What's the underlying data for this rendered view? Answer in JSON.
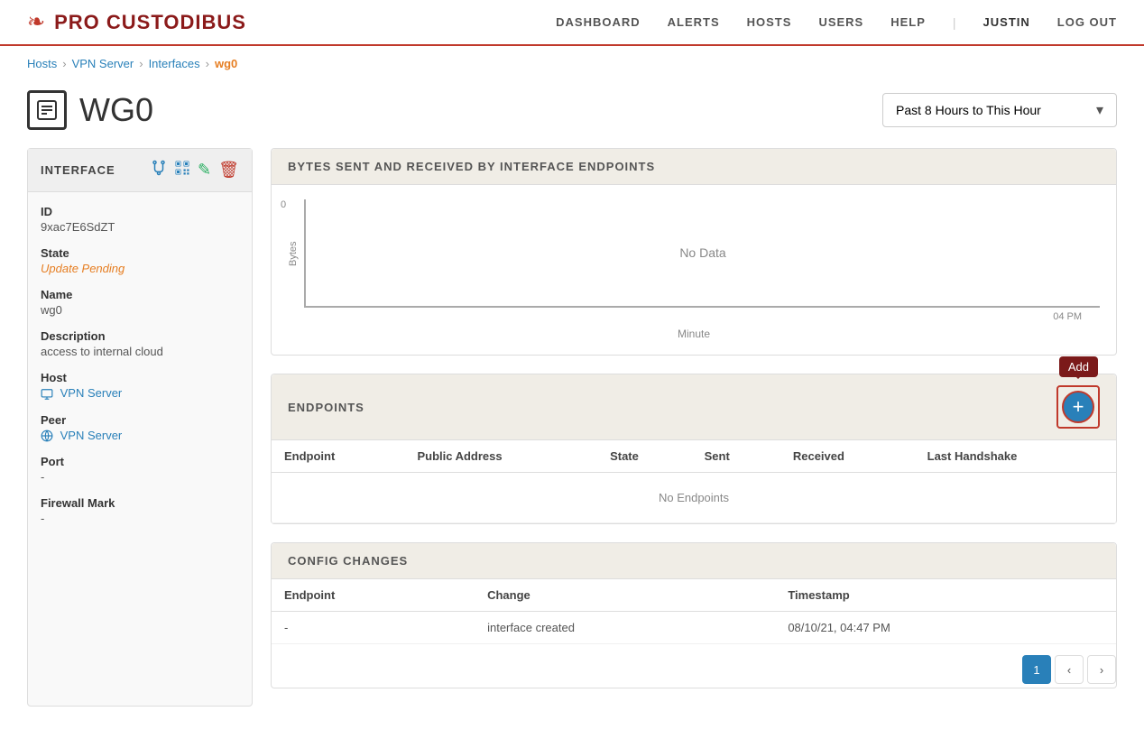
{
  "header": {
    "logo_text": "PRO CUSTODIBUS",
    "logo_icon": "❧",
    "nav": {
      "dashboard": "DASHBOARD",
      "alerts": "ALERTS",
      "hosts": "HOSTS",
      "users": "USERS",
      "help": "HELP",
      "username": "JUSTIN",
      "logout": "LOG OUT"
    }
  },
  "breadcrumb": {
    "hosts": "Hosts",
    "vpn_server": "VPN Server",
    "interfaces": "Interfaces",
    "current": "wg0"
  },
  "page_title": "WG0",
  "time_selector": {
    "label": "Past 8 Hours to This Hour",
    "chevron": "▾"
  },
  "sidebar": {
    "header_title": "INTERFACE",
    "icons": {
      "fork": "⑂",
      "qr": "⊞",
      "edit": "✎",
      "delete": "🗑"
    },
    "fields": {
      "id_label": "ID",
      "id_value": "9xac7E6SdZT",
      "state_label": "State",
      "state_value": "Update Pending",
      "name_label": "Name",
      "name_value": "wg0",
      "description_label": "Description",
      "description_value": "access to internal cloud",
      "host_label": "Host",
      "host_value": "VPN Server",
      "peer_label": "Peer",
      "peer_value": "VPN Server",
      "port_label": "Port",
      "port_value": "-",
      "firewall_mark_label": "Firewall Mark",
      "firewall_mark_value": "-"
    }
  },
  "chart_section": {
    "title": "BYTES SENT AND RECEIVED BY INTERFACE ENDPOINTS",
    "y_label": "Bytes",
    "x_label": "Minute",
    "zero": "0",
    "time_label": "04 PM",
    "no_data": "No Data"
  },
  "endpoints_section": {
    "title": "ENDPOINTS",
    "add_label": "Add",
    "add_icon": "+",
    "columns": {
      "endpoint": "Endpoint",
      "public_address": "Public Address",
      "state": "State",
      "sent": "Sent",
      "received": "Received",
      "last_handshake": "Last Handshake"
    },
    "no_data": "No Endpoints"
  },
  "config_section": {
    "title": "CONFIG CHANGES",
    "columns": {
      "endpoint": "Endpoint",
      "change": "Change",
      "timestamp": "Timestamp"
    },
    "rows": [
      {
        "endpoint": "-",
        "change": "interface created",
        "timestamp": "08/10/21, 04:47 PM"
      }
    ]
  },
  "pagination": {
    "current_page": "1",
    "prev_icon": "‹",
    "next_icon": "›"
  }
}
